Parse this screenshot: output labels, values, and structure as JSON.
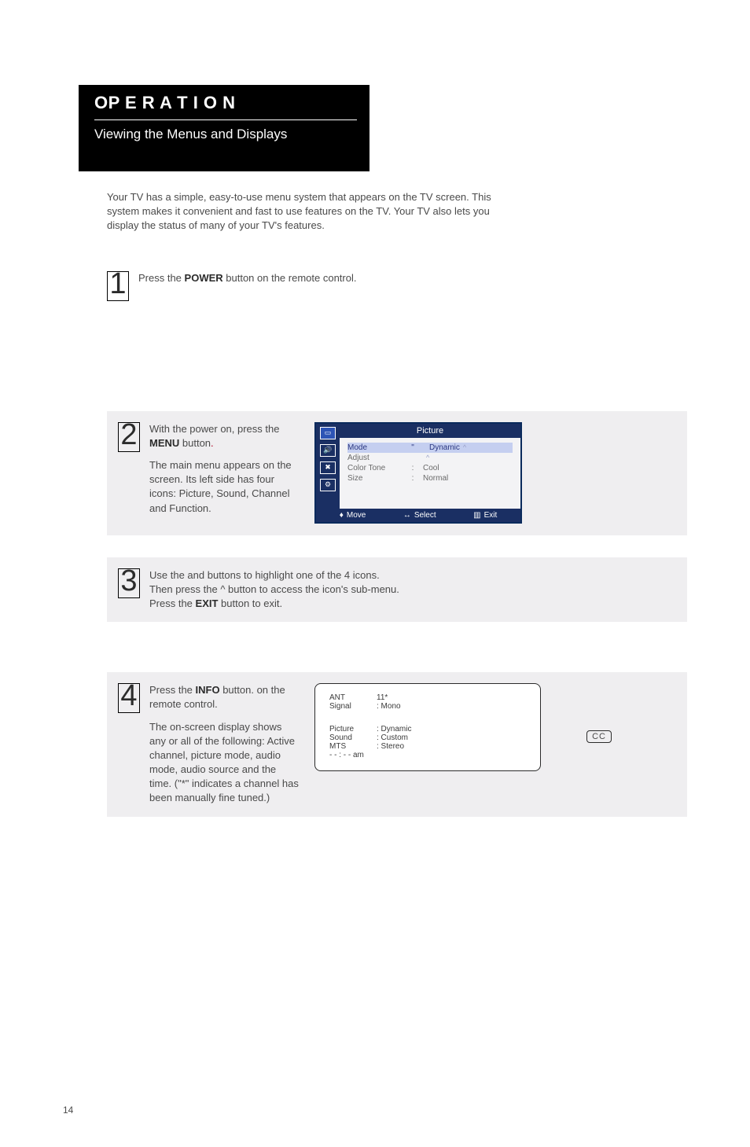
{
  "page_number": "14",
  "header": {
    "title": "OP E R A T I O N",
    "subtitle": "Viewing the Menus and Displays"
  },
  "intro": "Your TV has a simple, easy-to-use menu system that appears on the TV screen. This system makes it convenient and fast to use features on the TV. Your TV also lets you display the status of many of your TV's features.",
  "steps": {
    "1": {
      "num": "1",
      "body_pre": "Press the ",
      "bold": "POWER",
      "body_post": " button on the remote control."
    },
    "2": {
      "num": "2",
      "p1_pre": "With the power on, press the ",
      "p1_bold": "MENU",
      "p1_post": " button",
      "p1_tail": ".",
      "p2": "The main menu appears on the screen. Its left side has four icons: Picture, Sound, Channel and Function."
    },
    "3": {
      "num": "3",
      "line1_a": "Use the ",
      "line1_b": " and ",
      "line1_c": " buttons to highlight one of the 4 icons.",
      "line2": "Then press the  ^  button to access the icon's sub-menu.",
      "line3_pre": "Press the ",
      "line3_bold": "EXIT",
      "line3_post": " button to exit."
    },
    "4": {
      "num": "4",
      "p1_pre": "Press the ",
      "p1_bold": "INFO",
      "p1_post": " button. on the remote control.",
      "p2": "The on-screen display shows any or all of the following: Active channel, picture mode, audio mode, audio source and the time. (\"*\" indicates a channel has been manually fine tuned.)"
    }
  },
  "osd": {
    "title": "Picture",
    "rows": [
      {
        "k": "Mode",
        "v": "Dynamic",
        "selected": true,
        "colon": "\"",
        "arrows": true
      },
      {
        "k": "Adjust",
        "v": "",
        "selected": false,
        "colon": "",
        "arrows": true
      },
      {
        "k": "Color Tone",
        "v": "Cool",
        "selected": false,
        "colon": ":",
        "arrows": false
      },
      {
        "k": "Size",
        "v": "Normal",
        "selected": false,
        "colon": ":",
        "arrows": false
      }
    ],
    "footer": {
      "move": "Move",
      "select": "Select",
      "exit": "Exit"
    }
  },
  "info_osd": {
    "top": [
      {
        "k": "ANT",
        "v": "11*"
      },
      {
        "k": "Signal",
        "v": ": Mono"
      }
    ],
    "bottom": [
      {
        "k": "Picture",
        "v": ": Dynamic"
      },
      {
        "k": "Sound",
        "v": ": Custom"
      },
      {
        "k": "MTS",
        "v": ": Stereo"
      },
      {
        "k": "- - : - -  am",
        "v": ""
      }
    ]
  },
  "cc_label": "CC"
}
